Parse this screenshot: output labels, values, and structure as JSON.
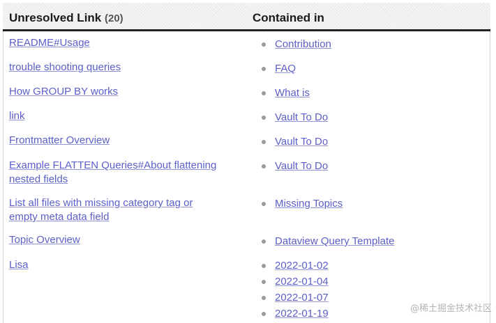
{
  "table": {
    "header": {
      "col1": "Unresolved Link",
      "count": "(20)",
      "col2": "Contained in"
    },
    "rows": [
      {
        "link": "README#Usage",
        "contained": [
          "Contribution"
        ]
      },
      {
        "link": "trouble shooting queries",
        "contained": [
          "FAQ"
        ]
      },
      {
        "link": "How GROUP BY works",
        "contained": [
          "What is"
        ]
      },
      {
        "link": "link",
        "contained": [
          "Vault To Do"
        ]
      },
      {
        "link": "Frontmatter Overview",
        "contained": [
          "Vault To Do"
        ]
      },
      {
        "link": "Example FLATTEN Queries#About flattening nested fields",
        "contained": [
          "Vault To Do"
        ]
      },
      {
        "link": "List all files with missing category tag or empty meta data field",
        "contained": [
          "Missing Topics"
        ]
      },
      {
        "link": "Topic Overview",
        "contained": [
          "Dataview Query Template"
        ]
      },
      {
        "link": "Lisa",
        "contained": [
          "2022-01-02",
          "2022-01-04",
          "2022-01-07",
          "2022-01-19"
        ]
      }
    ]
  },
  "watermark": "@稀土掘金技术社区",
  "colors": {
    "link": "#5b5fc7",
    "header_rule": "#222222",
    "bullet": "#9a9a9a"
  }
}
